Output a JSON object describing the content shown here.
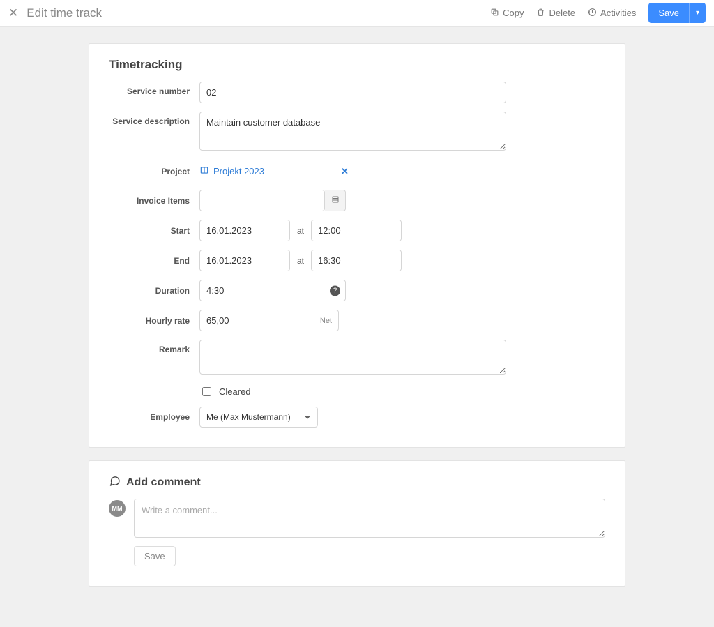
{
  "header": {
    "title": "Edit time track",
    "copy": "Copy",
    "delete": "Delete",
    "activities": "Activities",
    "save": "Save"
  },
  "form": {
    "section_title": "Timetracking",
    "labels": {
      "service_number": "Service number",
      "service_description": "Service description",
      "project": "Project",
      "invoice_items": "Invoice Items",
      "start": "Start",
      "end": "End",
      "at": "at",
      "duration": "Duration",
      "hourly_rate": "Hourly rate",
      "net": "Net",
      "remark": "Remark",
      "cleared": "Cleared",
      "employee": "Employee"
    },
    "values": {
      "service_number": "02",
      "service_description": "Maintain customer database",
      "project_name": "Projekt 2023",
      "invoice_items": "",
      "start_date": "16.01.2023",
      "start_time": "12:00",
      "end_date": "16.01.2023",
      "end_time": "16:30",
      "duration": "4:30",
      "hourly_rate": "65,00",
      "remark": "",
      "cleared": false,
      "employee": "Me (Max Mustermann)"
    }
  },
  "comments": {
    "title": "Add comment",
    "avatar_initials": "MM",
    "placeholder": "Write a comment...",
    "save": "Save"
  }
}
